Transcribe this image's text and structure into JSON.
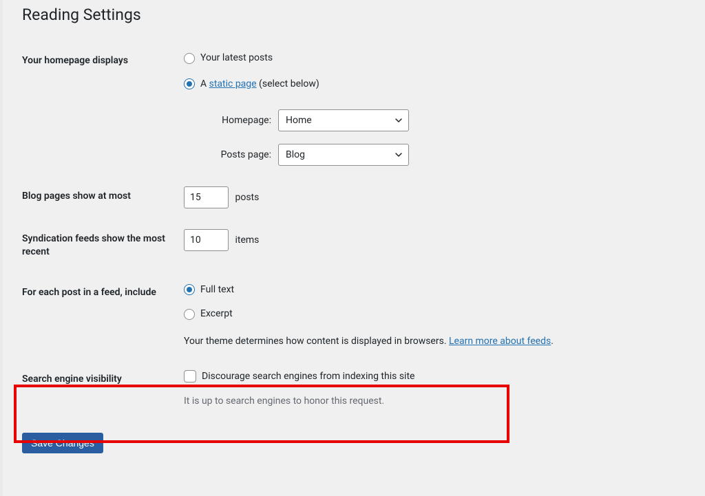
{
  "page_title": "Reading Settings",
  "homepage": {
    "row_label": "Your homepage displays",
    "opt_latest": "Your latest posts",
    "opt_static_prefix": "A ",
    "opt_static_link": "static page",
    "opt_static_suffix": " (select below)",
    "homepage_label": "Homepage:",
    "homepage_value": "Home",
    "posts_page_label": "Posts page:",
    "posts_page_value": "Blog"
  },
  "blog_pages": {
    "row_label": "Blog pages show at most",
    "value": "15",
    "unit": "posts"
  },
  "syndication": {
    "row_label": "Syndication feeds show the most recent",
    "value": "10",
    "unit": "items"
  },
  "feed_include": {
    "row_label": "For each post in a feed, include",
    "opt_full": "Full text",
    "opt_excerpt": "Excerpt",
    "desc_prefix": "Your theme determines how content is displayed in browsers. ",
    "desc_link": "Learn more about feeds",
    "desc_suffix": "."
  },
  "search_vis": {
    "row_label": "Search engine visibility",
    "checkbox_label": "Discourage search engines from indexing this site",
    "description": "It is up to search engines to honor this request."
  },
  "submit": {
    "label": "Save Changes"
  }
}
